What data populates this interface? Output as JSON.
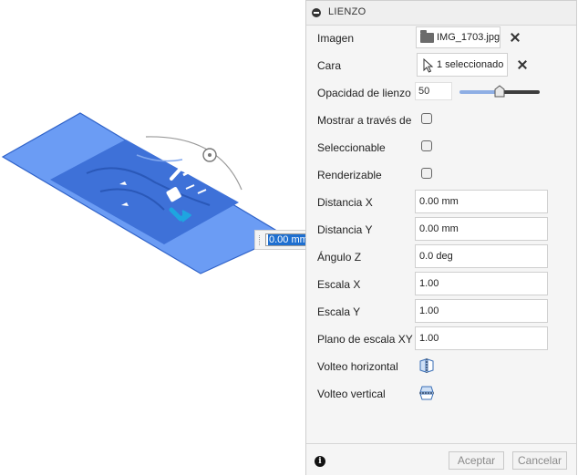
{
  "viewport": {
    "distance_input_value": "0.00 mm"
  },
  "panel": {
    "title": "LIENZO",
    "rows": {
      "imagen": {
        "label": "Imagen",
        "file_name": "IMG_1703.jpg"
      },
      "cara": {
        "label": "Cara",
        "selection": "1 seleccionado"
      },
      "opacidad": {
        "label": "Opacidad de lienzo",
        "value": "50",
        "slider_fraction": 0.5
      },
      "mostrar": {
        "label": "Mostrar a través de",
        "checked": false
      },
      "seleccionable": {
        "label": "Seleccionable",
        "checked": false
      },
      "renderizable": {
        "label": "Renderizable",
        "checked": false
      },
      "distancia_x": {
        "label": "Distancia X",
        "value": "0.00 mm"
      },
      "distancia_y": {
        "label": "Distancia Y",
        "value": "0.00 mm"
      },
      "angulo_z": {
        "label": "Ángulo Z",
        "value": "0.0 deg"
      },
      "escala_x": {
        "label": "Escala X",
        "value": "1.00"
      },
      "escala_y": {
        "label": "Escala Y",
        "value": "1.00"
      },
      "plano_xy": {
        "label": "Plano de escala XY",
        "value": "1.00"
      },
      "volteo_h": {
        "label": "Volteo horizontal",
        "icon": "flip-horizontal-icon"
      },
      "volteo_v": {
        "label": "Volteo vertical",
        "icon": "flip-vertical-icon"
      }
    },
    "footer": {
      "ok_label": "Aceptar",
      "cancel_label": "Cancelar"
    }
  },
  "colors": {
    "plane_blue": "#4d86f0",
    "plane_dark": "#2f5fc4",
    "manipulator_cyan": "#1ea5e0",
    "panel_bg": "#f5f5f5",
    "slider_fill": "#8eaee4"
  }
}
